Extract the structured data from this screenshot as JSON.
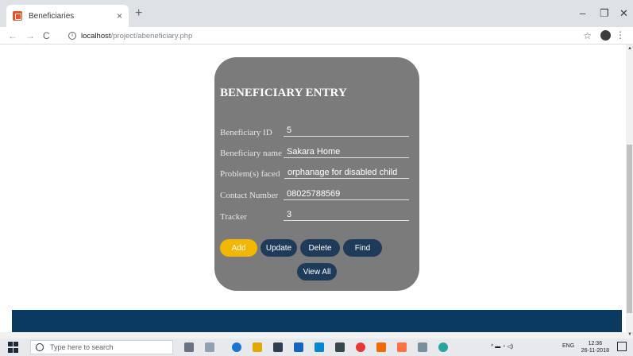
{
  "browser": {
    "tab_title": "Beneficiaries",
    "tab_close": "×",
    "new_tab": "+",
    "window_controls": {
      "minimize": "–",
      "maximize": "❐",
      "close": "✕"
    },
    "url_host": "localhost",
    "url_path": "/project/abeneficiary.php"
  },
  "form": {
    "title": "BENEFICIARY ENTRY",
    "fields": [
      {
        "label": "Beneficiary ID",
        "value": "5"
      },
      {
        "label": "Beneficiary name",
        "value": "Sakara Home"
      },
      {
        "label": "Problem(s) faced",
        "value": "orphanage for disabled child"
      },
      {
        "label": "Contact Number",
        "value": "08025788569"
      },
      {
        "label": "Tracker",
        "value": "3"
      }
    ],
    "buttons": {
      "add": "Add",
      "update": "Update",
      "delete": "Delete",
      "find": "Find",
      "view_all": "View All"
    }
  },
  "colors": {
    "card_bg": "#7b7b7b",
    "button_bg": "#1f3b5a",
    "add_button_bg": "#f2b705",
    "footer_bg": "#0b3a60"
  },
  "taskbar": {
    "search_placeholder": "Type here to search",
    "language": "ENG",
    "time": "12:36",
    "date": "26-11-2018"
  }
}
